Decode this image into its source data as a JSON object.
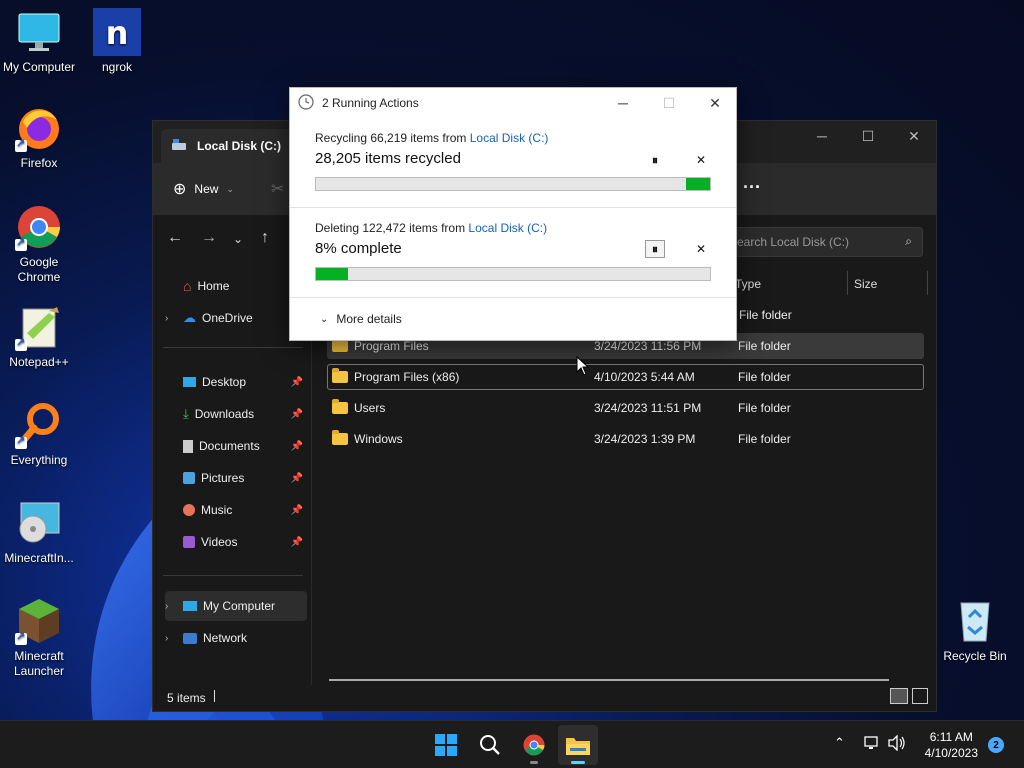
{
  "desktop": {
    "icons": [
      {
        "label": "My Computer",
        "icon": "monitor-icon"
      },
      {
        "label": "ngrok",
        "icon": "ngrok-icon"
      },
      {
        "label": "Firefox",
        "icon": "firefox-icon"
      },
      {
        "label": "Google Chrome",
        "icon": "chrome-icon"
      },
      {
        "label": "Notepad++",
        "icon": "notepadpp-icon"
      },
      {
        "label": "Everything",
        "icon": "everything-icon"
      },
      {
        "label": "MinecraftIn...",
        "icon": "installer-icon"
      },
      {
        "label": "Minecraft Launcher",
        "icon": "minecraft-icon"
      },
      {
        "label": "Recycle Bin",
        "icon": "recycle-bin-icon"
      }
    ]
  },
  "explorer": {
    "tab_title": "Local Disk (C:)",
    "toolbar": {
      "new_label": "New"
    },
    "search_placeholder": "Search Local Disk (C:)",
    "sidebar": {
      "top": [
        {
          "label": "Home",
          "icon": "home-icon"
        },
        {
          "label": "OneDrive",
          "icon": "cloud-icon"
        }
      ],
      "pinned": [
        {
          "label": "Desktop",
          "icon": "desktop-icon"
        },
        {
          "label": "Downloads",
          "icon": "download-icon"
        },
        {
          "label": "Documents",
          "icon": "document-icon"
        },
        {
          "label": "Pictures",
          "icon": "picture-icon"
        },
        {
          "label": "Music",
          "icon": "music-icon"
        },
        {
          "label": "Videos",
          "icon": "video-icon"
        }
      ],
      "bottom": [
        {
          "label": "My Computer",
          "icon": "computer-icon"
        },
        {
          "label": "Network",
          "icon": "network-icon"
        }
      ]
    },
    "columns": {
      "type": "Type",
      "size": "Size"
    },
    "rows": [
      {
        "name": "",
        "date": "",
        "type": "File folder"
      },
      {
        "name": "Program Files",
        "date": "3/24/2023 11:56 PM",
        "type": "File folder"
      },
      {
        "name": "Program Files (x86)",
        "date": "4/10/2023 5:44 AM",
        "type": "File folder"
      },
      {
        "name": "Users",
        "date": "3/24/2023 11:51 PM",
        "type": "File folder"
      },
      {
        "name": "Windows",
        "date": "3/24/2023 1:39 PM",
        "type": "File folder"
      }
    ],
    "status": "5 items"
  },
  "dialog": {
    "title": "2 Running Actions",
    "actions": [
      {
        "line1_prefix": "Recycling 66,219 items from ",
        "line1_link": "Local Disk (C:)",
        "line2": "28,205 items recycled",
        "progress": 0.06,
        "progress_from_right": true,
        "pause_glyph": "⏸",
        "cancel_glyph": "✕"
      },
      {
        "line1_prefix": "Deleting 122,472 items from ",
        "line1_link": "Local Disk (C:)",
        "line2": "8% complete",
        "progress": 0.08,
        "progress_from_right": false,
        "pause_glyph": "⏸",
        "cancel_glyph": "✕"
      }
    ],
    "more_details": "More details"
  },
  "taskbar": {
    "time": "6:11 AM",
    "date": "4/10/2023",
    "notification_count": "2"
  },
  "colors": {
    "progress_green": "#06b025",
    "link_blue": "#1560bd",
    "accent": "#60cdff"
  }
}
